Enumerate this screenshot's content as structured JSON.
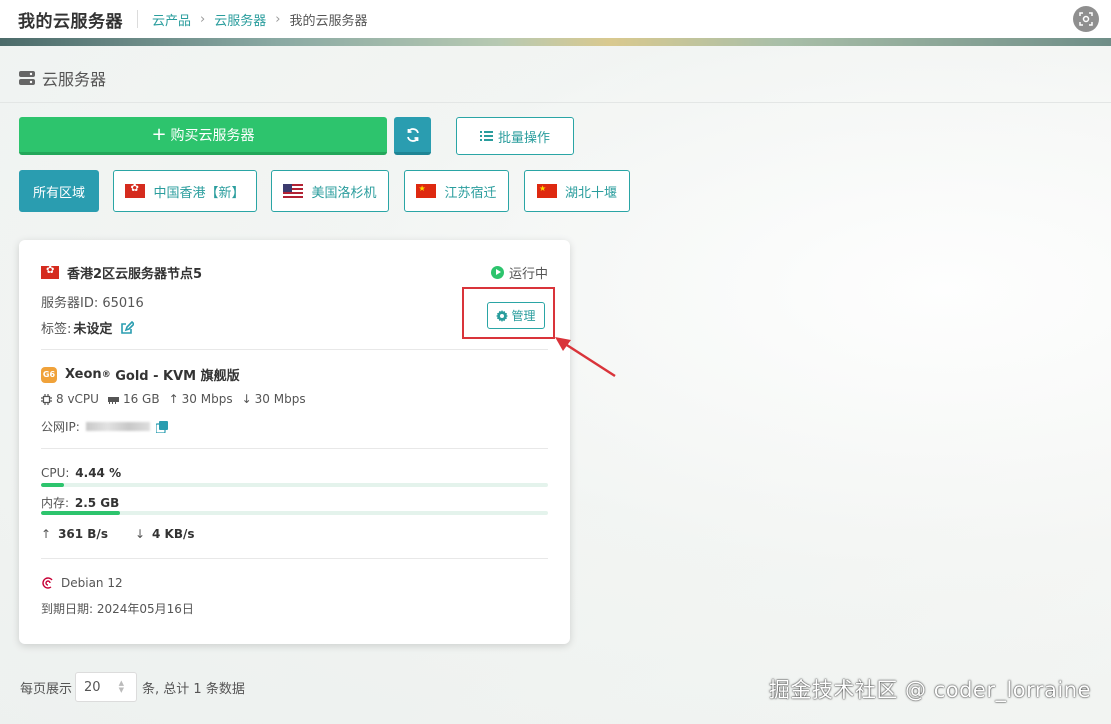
{
  "header": {
    "app_title": "我的云服务器",
    "breadcrumb": [
      "云产品",
      "云服务器",
      "我的云服务器"
    ],
    "right_icon": "scan-icon"
  },
  "section": {
    "title": "云服务器",
    "icon": "server-icon"
  },
  "toolbar": {
    "buy_label": "购买云服务器",
    "refresh_icon": "refresh-icon",
    "batch_label": "批量操作"
  },
  "regions": [
    {
      "label": "所有区域",
      "flag": "",
      "active": true
    },
    {
      "label": "中国香港【新】",
      "flag": "hk"
    },
    {
      "label": "美国洛杉机",
      "flag": "us"
    },
    {
      "label": "江苏宿迁",
      "flag": "cn"
    },
    {
      "label": "湖北十堰",
      "flag": "cn"
    }
  ],
  "server": {
    "name": "香港2区云服务器节点5",
    "status": "运行中",
    "id_label": "服务器ID: 65016",
    "tag_label": "标签:",
    "tag_value": "未设定",
    "manage_label": "管理",
    "cpu_badge": "G6",
    "cpu_model_pre": "Xeon",
    "cpu_model_sup": "®",
    "cpu_model_post": " Gold - KVM 旗舰版",
    "specs": {
      "vcpu": "8 vCPU",
      "memory": "16 GB",
      "upload": "30 Mbps",
      "download": "30 Mbps"
    },
    "public_ip_label": "公网IP:",
    "cpu_label": "CPU:",
    "cpu_value": "4.44 %",
    "cpu_usage_fraction": 0.0444,
    "mem_label": "内存:",
    "mem_value": "2.5 GB",
    "mem_usage_fraction": 0.156,
    "net_up": "361 B/s",
    "net_down": "4 KB/s",
    "os": "Debian 12",
    "expire": "到期日期: 2024年05月16日"
  },
  "pager": {
    "prefix": "每页展示",
    "page_size": "20",
    "suffix": "条, 总计 1 条数据"
  },
  "watermark": "掘金技术社区 @ coder_lorraine",
  "colors": {
    "accent": "#2a9db0",
    "green": "#2dc46d",
    "highlight_red": "#d9343a"
  }
}
